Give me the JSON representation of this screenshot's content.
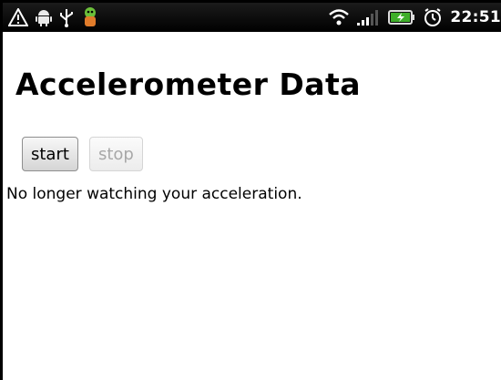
{
  "status_bar": {
    "left_icons": [
      "warning-icon",
      "android-icon",
      "usb-icon",
      "app-icon"
    ],
    "right_icons": [
      "wifi-icon",
      "signal-icon",
      "battery-icon",
      "alarm-icon"
    ],
    "time": "22:51"
  },
  "page": {
    "title": "Accelerometer Data",
    "start_label": "start",
    "stop_label": "stop",
    "status_message": "No longer watching your acceleration."
  },
  "colors": {
    "status_bar_bg": "#000000",
    "battery_green": "#3fae2a",
    "disabled_text": "#a8a8a8"
  }
}
